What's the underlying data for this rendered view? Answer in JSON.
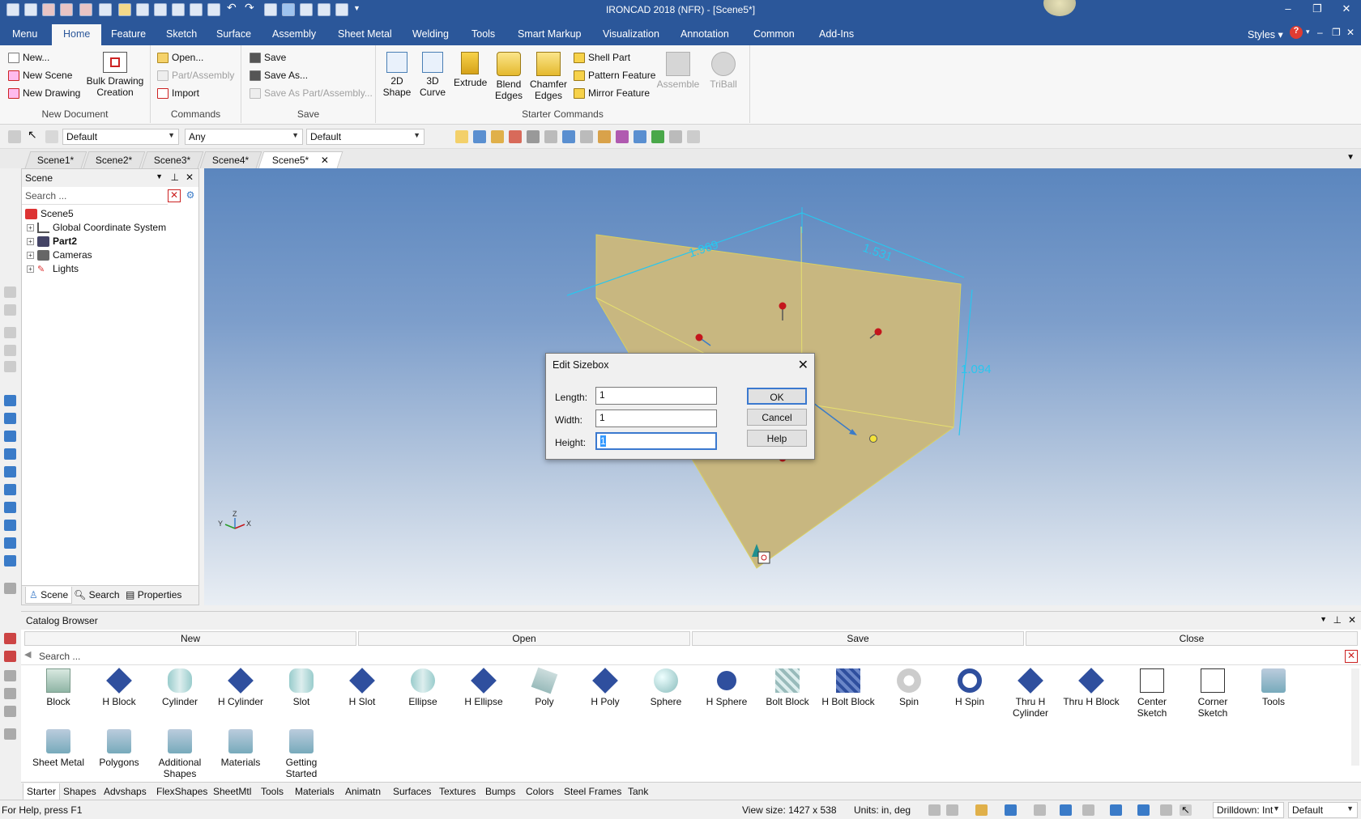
{
  "window": {
    "title": "IRONCAD 2018 (NFR) - [Scene5*]"
  },
  "menu": {
    "tabs": [
      "Menu",
      "Home",
      "Feature",
      "Sketch",
      "Surface",
      "Assembly",
      "Sheet Metal",
      "Welding",
      "Tools",
      "Smart Markup",
      "Visualization",
      "Annotation",
      "Common",
      "Add-Ins"
    ],
    "styles_label": "Styles"
  },
  "ribbon": {
    "new_document": {
      "new": "New...",
      "new_scene": "New Scene",
      "new_drawing": "New Drawing",
      "bulk_drawing": "Bulk Drawing Creation",
      "group": "New Document"
    },
    "commands": {
      "open": "Open...",
      "part_assembly": "Part/Assembly",
      "import": "Import",
      "group": "Commands"
    },
    "save": {
      "save": "Save",
      "save_as": "Save As...",
      "save_as_part": "Save As Part/Assembly...",
      "group": "Save"
    },
    "starter": {
      "shape2d": "2D Shape",
      "curve3d": "3D Curve",
      "extrude": "Extrude",
      "blend": "Blend Edges",
      "chamfer": "Chamfer Edges",
      "shell": "Shell Part",
      "pattern": "Pattern Feature",
      "mirror": "Mirror Feature",
      "assemble": "Assemble",
      "triball": "TriBall",
      "group": "Starter Commands"
    }
  },
  "toolbar": {
    "combo1": "Default",
    "combo2": "Any",
    "combo3": "Default"
  },
  "doc_tabs": [
    "Scene1*",
    "Scene2*",
    "Scene3*",
    "Scene4*",
    "Scene5*"
  ],
  "scene_panel": {
    "title": "Scene",
    "search_placeholder": "Search ...",
    "tree": [
      "Scene5",
      "Global Coordinate System",
      "Part2",
      "Cameras",
      "Lights"
    ],
    "tabs": [
      "Scene",
      "Search",
      "Properties"
    ]
  },
  "viewport": {
    "dim_length": "1.969",
    "dim_width": "1.531",
    "dim_height": "1.094"
  },
  "dialog": {
    "title": "Edit Sizebox",
    "length_label": "Length:",
    "length_value": "1",
    "width_label": "Width:",
    "width_value": "1",
    "height_label": "Height:",
    "height_value": "1",
    "ok": "OK",
    "cancel": "Cancel",
    "help": "Help"
  },
  "catalog": {
    "title": "Catalog Browser",
    "actions": [
      "New",
      "Open",
      "Save",
      "Close"
    ],
    "search_placeholder": "Search ...",
    "items": [
      "Block",
      "H Block",
      "Cylinder",
      "H Cylinder",
      "Slot",
      "H Slot",
      "Ellipse",
      "H Ellipse",
      "Poly",
      "H Poly",
      "Sphere",
      "H Sphere",
      "Bolt Block",
      "H Bolt Block",
      "Spin",
      "H Spin",
      "Thru H Cylinder",
      "Thru H Block",
      "Center Sketch",
      "Corner Sketch",
      "Tools",
      "Sheet Metal",
      "Polygons",
      "Additional Shapes",
      "Materials",
      "Getting Started"
    ],
    "tabs": [
      "Starter",
      "Shapes",
      "Advshaps",
      "FlexShapes",
      "SheetMtl",
      "Tools",
      "Materials",
      "Animatn",
      "Surfaces",
      "Textures",
      "Bumps",
      "Colors",
      "Steel Frames",
      "Tank"
    ]
  },
  "status": {
    "help": "For Help, press F1",
    "view_size": "View size: 1427 x  538",
    "units": "Units: in, deg",
    "drilldown": "Drilldown: Int",
    "mode": "Default"
  },
  "colors": {
    "brand": "#2b579a",
    "part": "#d8c891",
    "dim": "#29c6ee"
  }
}
